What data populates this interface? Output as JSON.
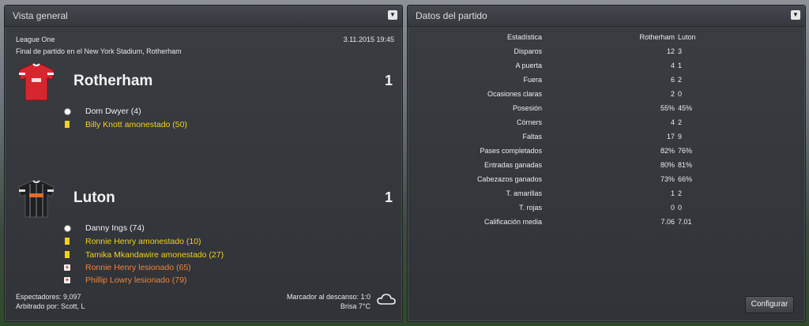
{
  "overview": {
    "title": "Vista general",
    "competition": "League One",
    "datetime": "3.11.2015 19:45",
    "venue": "Final de partido en el New York Stadium, Rotherham",
    "home": {
      "name": "Rotherham",
      "score": "1",
      "events": [
        {
          "icon": "ball-icon",
          "text": "Dom Dwyer (4)",
          "color": "white"
        },
        {
          "icon": "yellow-card-icon",
          "text": "Billy Knott amonestado (50)",
          "color": "yellow"
        }
      ]
    },
    "away": {
      "name": "Luton",
      "score": "1",
      "events": [
        {
          "icon": "ball-icon",
          "text": "Danny Ings (74)",
          "color": "white"
        },
        {
          "icon": "yellow-card-icon",
          "text": "Ronnie Henry amonestado (10)",
          "color": "yellow"
        },
        {
          "icon": "yellow-card-icon",
          "text": "Tamika Mkandawire amonestado (27)",
          "color": "yellow"
        },
        {
          "icon": "injury-icon",
          "text": "Ronnie Henry lesionado (65)",
          "color": "orange"
        },
        {
          "icon": "injury-icon",
          "text": "Phillip Lowry lesionado (79)",
          "color": "orange"
        }
      ]
    },
    "attendance": "Espectadores: 9,097",
    "referee": "Arbitrado por: Scott, L",
    "halftime": "Marcador al descanso: 1:0",
    "weather": "Brisa 7°C",
    "weather_icon": "cloud-icon"
  },
  "stats": {
    "title": "Datos del partido",
    "header": {
      "label": "Estadística",
      "home": "Rotherham",
      "away": "Luton"
    },
    "rows": [
      {
        "label": "Disparos",
        "home": "12",
        "away": "3"
      },
      {
        "label": "A puerta",
        "home": "4",
        "away": "1"
      },
      {
        "label": "Fuera",
        "home": "6",
        "away": "2"
      },
      {
        "label": "Ocasiones claras",
        "home": "2",
        "away": "0"
      },
      {
        "label": "Posesión",
        "home": "55%",
        "away": "45%"
      },
      {
        "label": "Córners",
        "home": "4",
        "away": "2"
      },
      {
        "label": "Faltas",
        "home": "17",
        "away": "9"
      },
      {
        "label": "Pases completados",
        "home": "82%",
        "away": "76%"
      },
      {
        "label": "Entradas ganadas",
        "home": "80%",
        "away": "81%"
      },
      {
        "label": "Cabezazos ganados",
        "home": "73%",
        "away": "66%"
      },
      {
        "label": "T. amarillas",
        "home": "1",
        "away": "2"
      },
      {
        "label": "T. rojas",
        "home": "0",
        "away": "0"
      },
      {
        "label": "Calificación media",
        "home": "7.06",
        "away": "7.01"
      }
    ],
    "configure_label": "Configurar"
  },
  "colors": {
    "yellow": "#f3d11a",
    "orange": "#f0843a",
    "home_kit": "#d8262e",
    "away_kit": "#1d1f22"
  }
}
